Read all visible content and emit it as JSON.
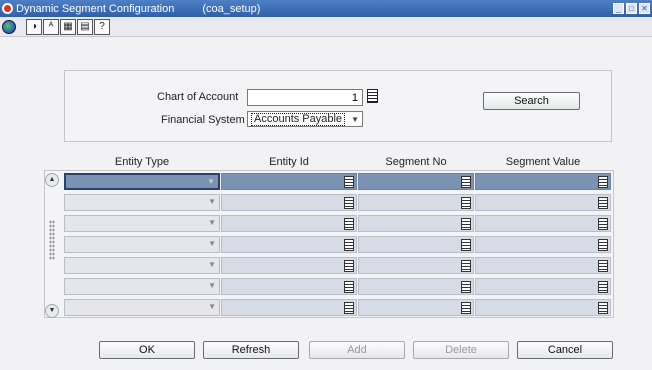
{
  "window": {
    "title": "Dynamic Segment Configuration",
    "module": "(coa_setup)"
  },
  "toolbar": {
    "icons": [
      "globe-icon",
      "wizard-icon",
      "spell-icon",
      "calendar-icon",
      "print-icon",
      "help-icon"
    ]
  },
  "header": {
    "chart_of_account_label": "Chart of Account",
    "chart_of_account_value": "1",
    "financial_system_label": "Financial System",
    "financial_system_value": "Accounts Payable",
    "search_label": "Search"
  },
  "grid": {
    "columns": [
      "Entity Type",
      "Entity Id",
      "Segment No",
      "Segment Value"
    ],
    "rows": [
      {
        "entity_type": "",
        "entity_id": "",
        "segment_no": "",
        "segment_value": "",
        "selected": true
      },
      {
        "entity_type": "",
        "entity_id": "",
        "segment_no": "",
        "segment_value": ""
      },
      {
        "entity_type": "",
        "entity_id": "",
        "segment_no": "",
        "segment_value": ""
      },
      {
        "entity_type": "",
        "entity_id": "",
        "segment_no": "",
        "segment_value": ""
      },
      {
        "entity_type": "",
        "entity_id": "",
        "segment_no": "",
        "segment_value": ""
      },
      {
        "entity_type": "",
        "entity_id": "",
        "segment_no": "",
        "segment_value": ""
      },
      {
        "entity_type": "",
        "entity_id": "",
        "segment_no": "",
        "segment_value": ""
      }
    ]
  },
  "buttons": {
    "ok": "OK",
    "refresh": "Refresh",
    "add": "Add",
    "delete": "Delete",
    "cancel": "Cancel"
  },
  "colors": {
    "titlebar": "#2f5fa8",
    "selected_row": "#7c92b2",
    "cell": "#d6dbe6"
  }
}
